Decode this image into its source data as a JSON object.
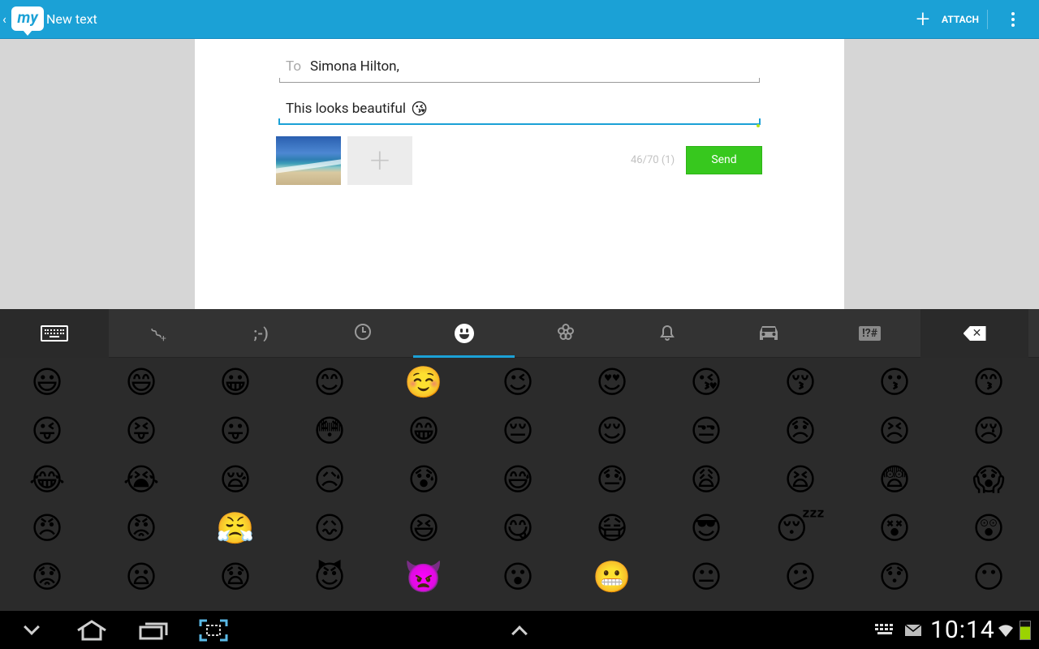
{
  "app": {
    "logo_text": "my",
    "title": "New text",
    "attach_label": "ATTACH"
  },
  "compose": {
    "to_label": "To",
    "to_value": "Simona Hilton,",
    "message_text": "This looks beautiful",
    "message_emoji": "😘",
    "char_counter": "46/70 (1)",
    "send_label": "Send"
  },
  "keyboard": {
    "tabs": [
      {
        "name": "keyboard",
        "icon": "keyboard-icon"
      },
      {
        "name": "attachment",
        "icon": "paperclip-icon"
      },
      {
        "name": "emoticons",
        "glyph": ";-)"
      },
      {
        "name": "recent",
        "icon": "clock-icon"
      },
      {
        "name": "smileys",
        "icon": "smiley-icon",
        "active": true
      },
      {
        "name": "nature",
        "icon": "flower-icon"
      },
      {
        "name": "objects",
        "icon": "bell-icon"
      },
      {
        "name": "places",
        "icon": "car-icon"
      },
      {
        "name": "symbols",
        "glyph": "!?#"
      },
      {
        "name": "backspace",
        "icon": "backspace-icon"
      }
    ],
    "emoji_rows": [
      [
        "😃",
        "😄",
        "😀",
        "😊",
        "☺️",
        "😉",
        "😍",
        "😘",
        "😚",
        "😗",
        "😙"
      ],
      [
        "😜",
        "😝",
        "😛",
        "😳",
        "😁",
        "😔",
        "😌",
        "😒",
        "😞",
        "😣",
        "😢"
      ],
      [
        "😂",
        "😭",
        "😪",
        "😥",
        "😰",
        "😅",
        "😓",
        "😩",
        "😫",
        "😨",
        "😱"
      ],
      [
        "😠",
        "😡",
        "😤",
        "😖",
        "😆",
        "😋",
        "😷",
        "😎",
        "😴",
        "😵",
        "😲"
      ],
      [
        "😟",
        "😦",
        "😧",
        "😈",
        "👿",
        "😮",
        "😬",
        "😐",
        "😕",
        "😯",
        "😶"
      ]
    ]
  },
  "system": {
    "time": "10:14"
  }
}
